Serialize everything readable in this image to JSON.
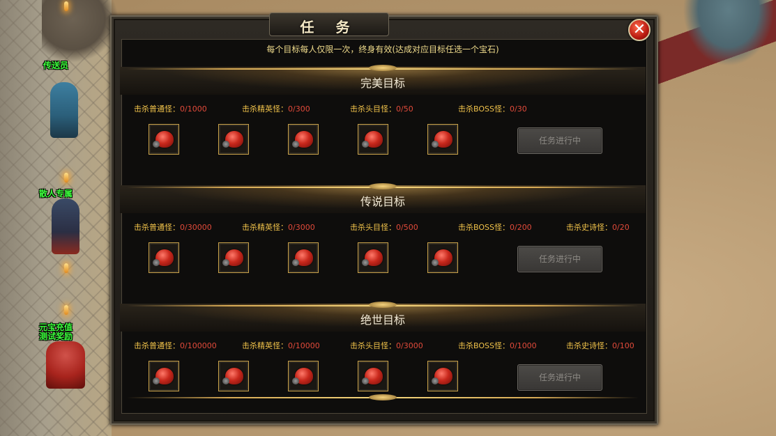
{
  "dialog": {
    "title": "任 务",
    "close_label": "✕",
    "notice": "每个目标每人仅限一次，终身有效(达成对应目标任选一个宝石)"
  },
  "npcs": [
    {
      "label": "传送员"
    },
    {
      "label": "散人专属"
    },
    {
      "label": "元宝充值\n测试奖励"
    }
  ],
  "sections": [
    {
      "title": "完美目标",
      "goals": [
        {
          "label": "击杀普通怪：",
          "value": "0/1000"
        },
        {
          "label": "击杀精英怪：",
          "value": "0/300"
        },
        {
          "label": "击杀头目怪：",
          "value": "0/50"
        },
        {
          "label": "击杀BOSS怪：",
          "value": "0/30"
        }
      ],
      "gems": [
        "red-gem",
        "red-gem",
        "red-gem",
        "red-gem",
        "red-gem"
      ],
      "button_label": "任务进行中"
    },
    {
      "title": "传说目标",
      "goals": [
        {
          "label": "击杀普通怪：",
          "value": "0/30000"
        },
        {
          "label": "击杀精英怪：",
          "value": "0/3000"
        },
        {
          "label": "击杀头目怪：",
          "value": "0/500"
        },
        {
          "label": "击杀BOSS怪：",
          "value": "0/200"
        },
        {
          "label": "击杀史诗怪：",
          "value": "0/20"
        }
      ],
      "gems": [
        "red-gem",
        "red-gem",
        "red-gem",
        "red-gem",
        "red-gem"
      ],
      "button_label": "任务进行中"
    },
    {
      "title": "绝世目标",
      "goals": [
        {
          "label": "击杀普通怪：",
          "value": "0/100000"
        },
        {
          "label": "击杀精英怪：",
          "value": "0/10000"
        },
        {
          "label": "击杀头目怪：",
          "value": "0/3000"
        },
        {
          "label": "击杀BOSS怪：",
          "value": "0/1000"
        },
        {
          "label": "击杀史诗怪：",
          "value": "0/100"
        }
      ],
      "gems": [
        "red-gem",
        "red-gem",
        "red-gem",
        "red-gem",
        "red-gem"
      ],
      "button_label": "任务进行中"
    }
  ],
  "colors": {
    "goal_label": "#f0c24a",
    "goal_value": "#e24a3a",
    "npc_label": "#3cff3c",
    "notice": "#f0dc8c"
  }
}
